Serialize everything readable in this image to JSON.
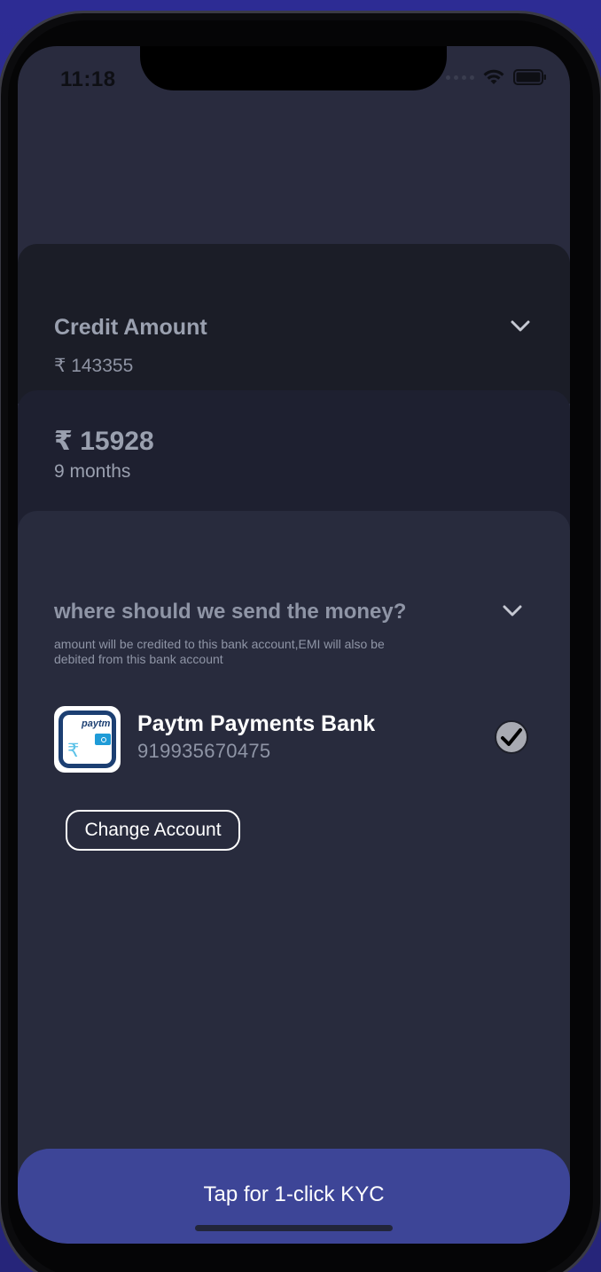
{
  "status": {
    "time": "11:18"
  },
  "credit": {
    "title": "Credit Amount",
    "value": "₹ 143355"
  },
  "emi": {
    "amount": "₹ 15928",
    "tenure": "9 months"
  },
  "bank": {
    "title": "where should we send the money?",
    "subtitle": "amount will be credited to this bank account,EMI will also be debited from this bank account",
    "name": "Paytm Payments Bank",
    "account": "919935670475",
    "logo_text": "paytm",
    "change_label": "Change Account"
  },
  "kyc": {
    "label": "Tap for 1-click KYC"
  },
  "icons": {
    "chevron": "chevron-down-icon",
    "check": "check-circle-icon",
    "wifi": "wifi-icon",
    "battery": "battery-icon"
  },
  "colors": {
    "screen_bg": "#292b3e",
    "kyc_button": "#3d4597",
    "text_muted": "#8f95a6"
  }
}
